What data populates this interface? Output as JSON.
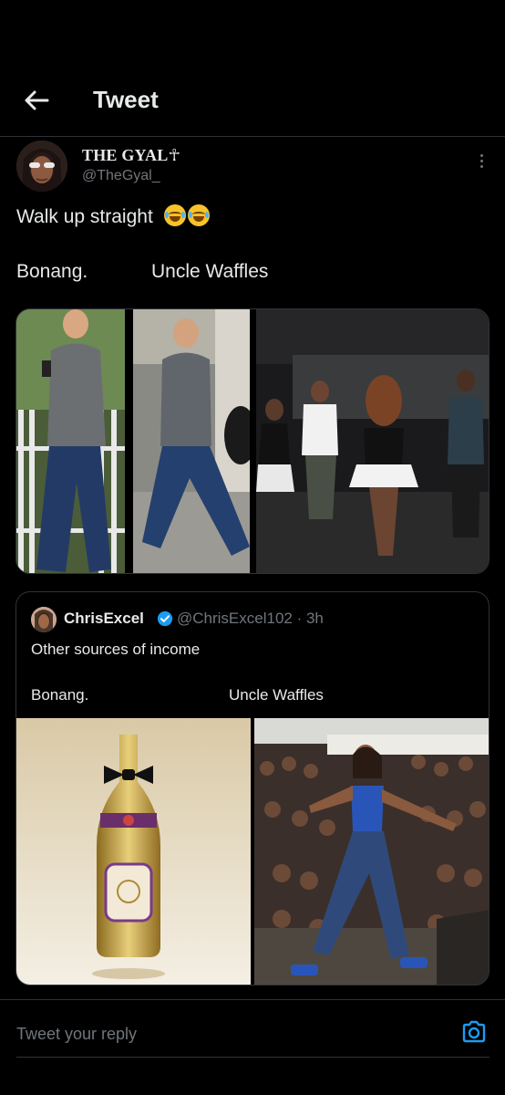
{
  "header": {
    "title": "Tweet",
    "back_icon": "arrow-left-icon"
  },
  "tweet": {
    "author": {
      "display_name": "THE GYAL",
      "name_glyph": "☥",
      "handle": "@TheGyal_"
    },
    "text": "Walk up straight",
    "emojis": [
      "face-with-tears-of-joy",
      "face-with-tears-of-joy"
    ],
    "captions": {
      "left": "Bonang.",
      "right": "Uncle Waffles"
    },
    "media": [
      "man-walking-phone-photo",
      "man-walking-sidewalk-photo",
      "women-dancing-night-photo"
    ]
  },
  "quote": {
    "author": {
      "display_name": "ChrisExcel",
      "handle_time": "@ChrisExcel102 · 3h",
      "verified_color": "#1d9bf0"
    },
    "text": "Other sources of income",
    "captions": {
      "left": "Bonang.",
      "right": "Uncle Waffles"
    },
    "media": [
      "gold-champagne-bottle-photo",
      "woman-dancing-crowd-photo"
    ]
  },
  "reply": {
    "placeholder": "Tweet your reply"
  },
  "colors": {
    "background": "#000000",
    "text": "#e7e9ea",
    "secondary": "#71767b",
    "accent": "#1d9bf0",
    "border": "#2f3336"
  }
}
